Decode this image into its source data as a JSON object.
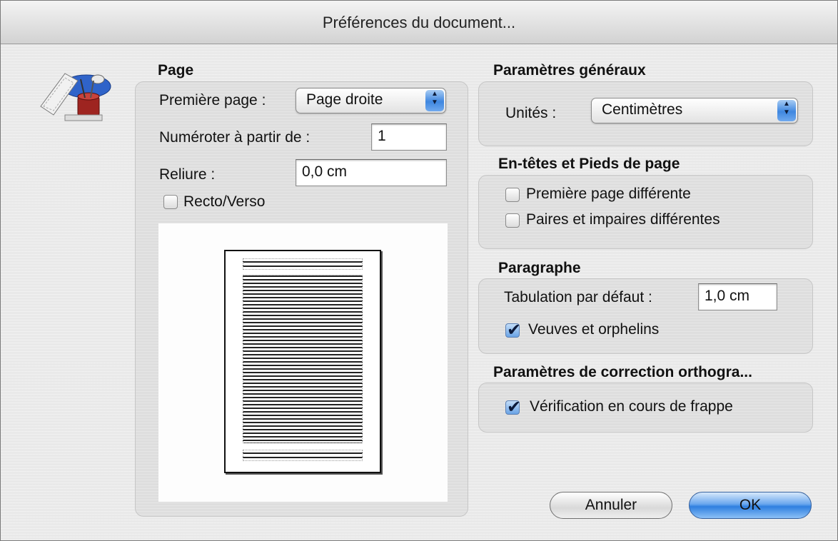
{
  "window": {
    "title": "Préférences du document..."
  },
  "page": {
    "section_title": "Page",
    "first_page_label": "Première page :",
    "first_page_value": "Page droite",
    "numbering_label": "Numéroter à partir de :",
    "numbering_value": "1",
    "binding_label": "Reliure :",
    "binding_value": "0,0 cm",
    "duplex_label": "Recto/Verso",
    "duplex_checked": false
  },
  "general": {
    "section_title": "Paramètres généraux",
    "units_label": "Unités :",
    "units_value": "Centimètres"
  },
  "headers_footers": {
    "section_title": "En-têtes et Pieds de page",
    "first_page_different_label": "Première page différente",
    "first_page_different_checked": false,
    "odd_even_different_label": "Paires et impaires différentes",
    "odd_even_different_checked": false
  },
  "paragraph": {
    "section_title": "Paragraphe",
    "default_tab_label": "Tabulation par défaut :",
    "default_tab_value": "1,0 cm",
    "widows_orphans_label": "Veuves et orphelins",
    "widows_orphans_checked": true
  },
  "spelling": {
    "section_title": "Paramètres de correction orthogra...",
    "check_as_you_type_label": "Vérification en cours de frappe",
    "check_as_you_type_checked": true
  },
  "buttons": {
    "cancel_label": "Annuler",
    "ok_label": "OK"
  },
  "icons": {
    "app_icon": "preferences-desk-icon",
    "popup_arrows": "up-down-arrows-icon"
  },
  "colors": {
    "accent": "#3f87e0",
    "window_bg": "#e9e9e9"
  }
}
